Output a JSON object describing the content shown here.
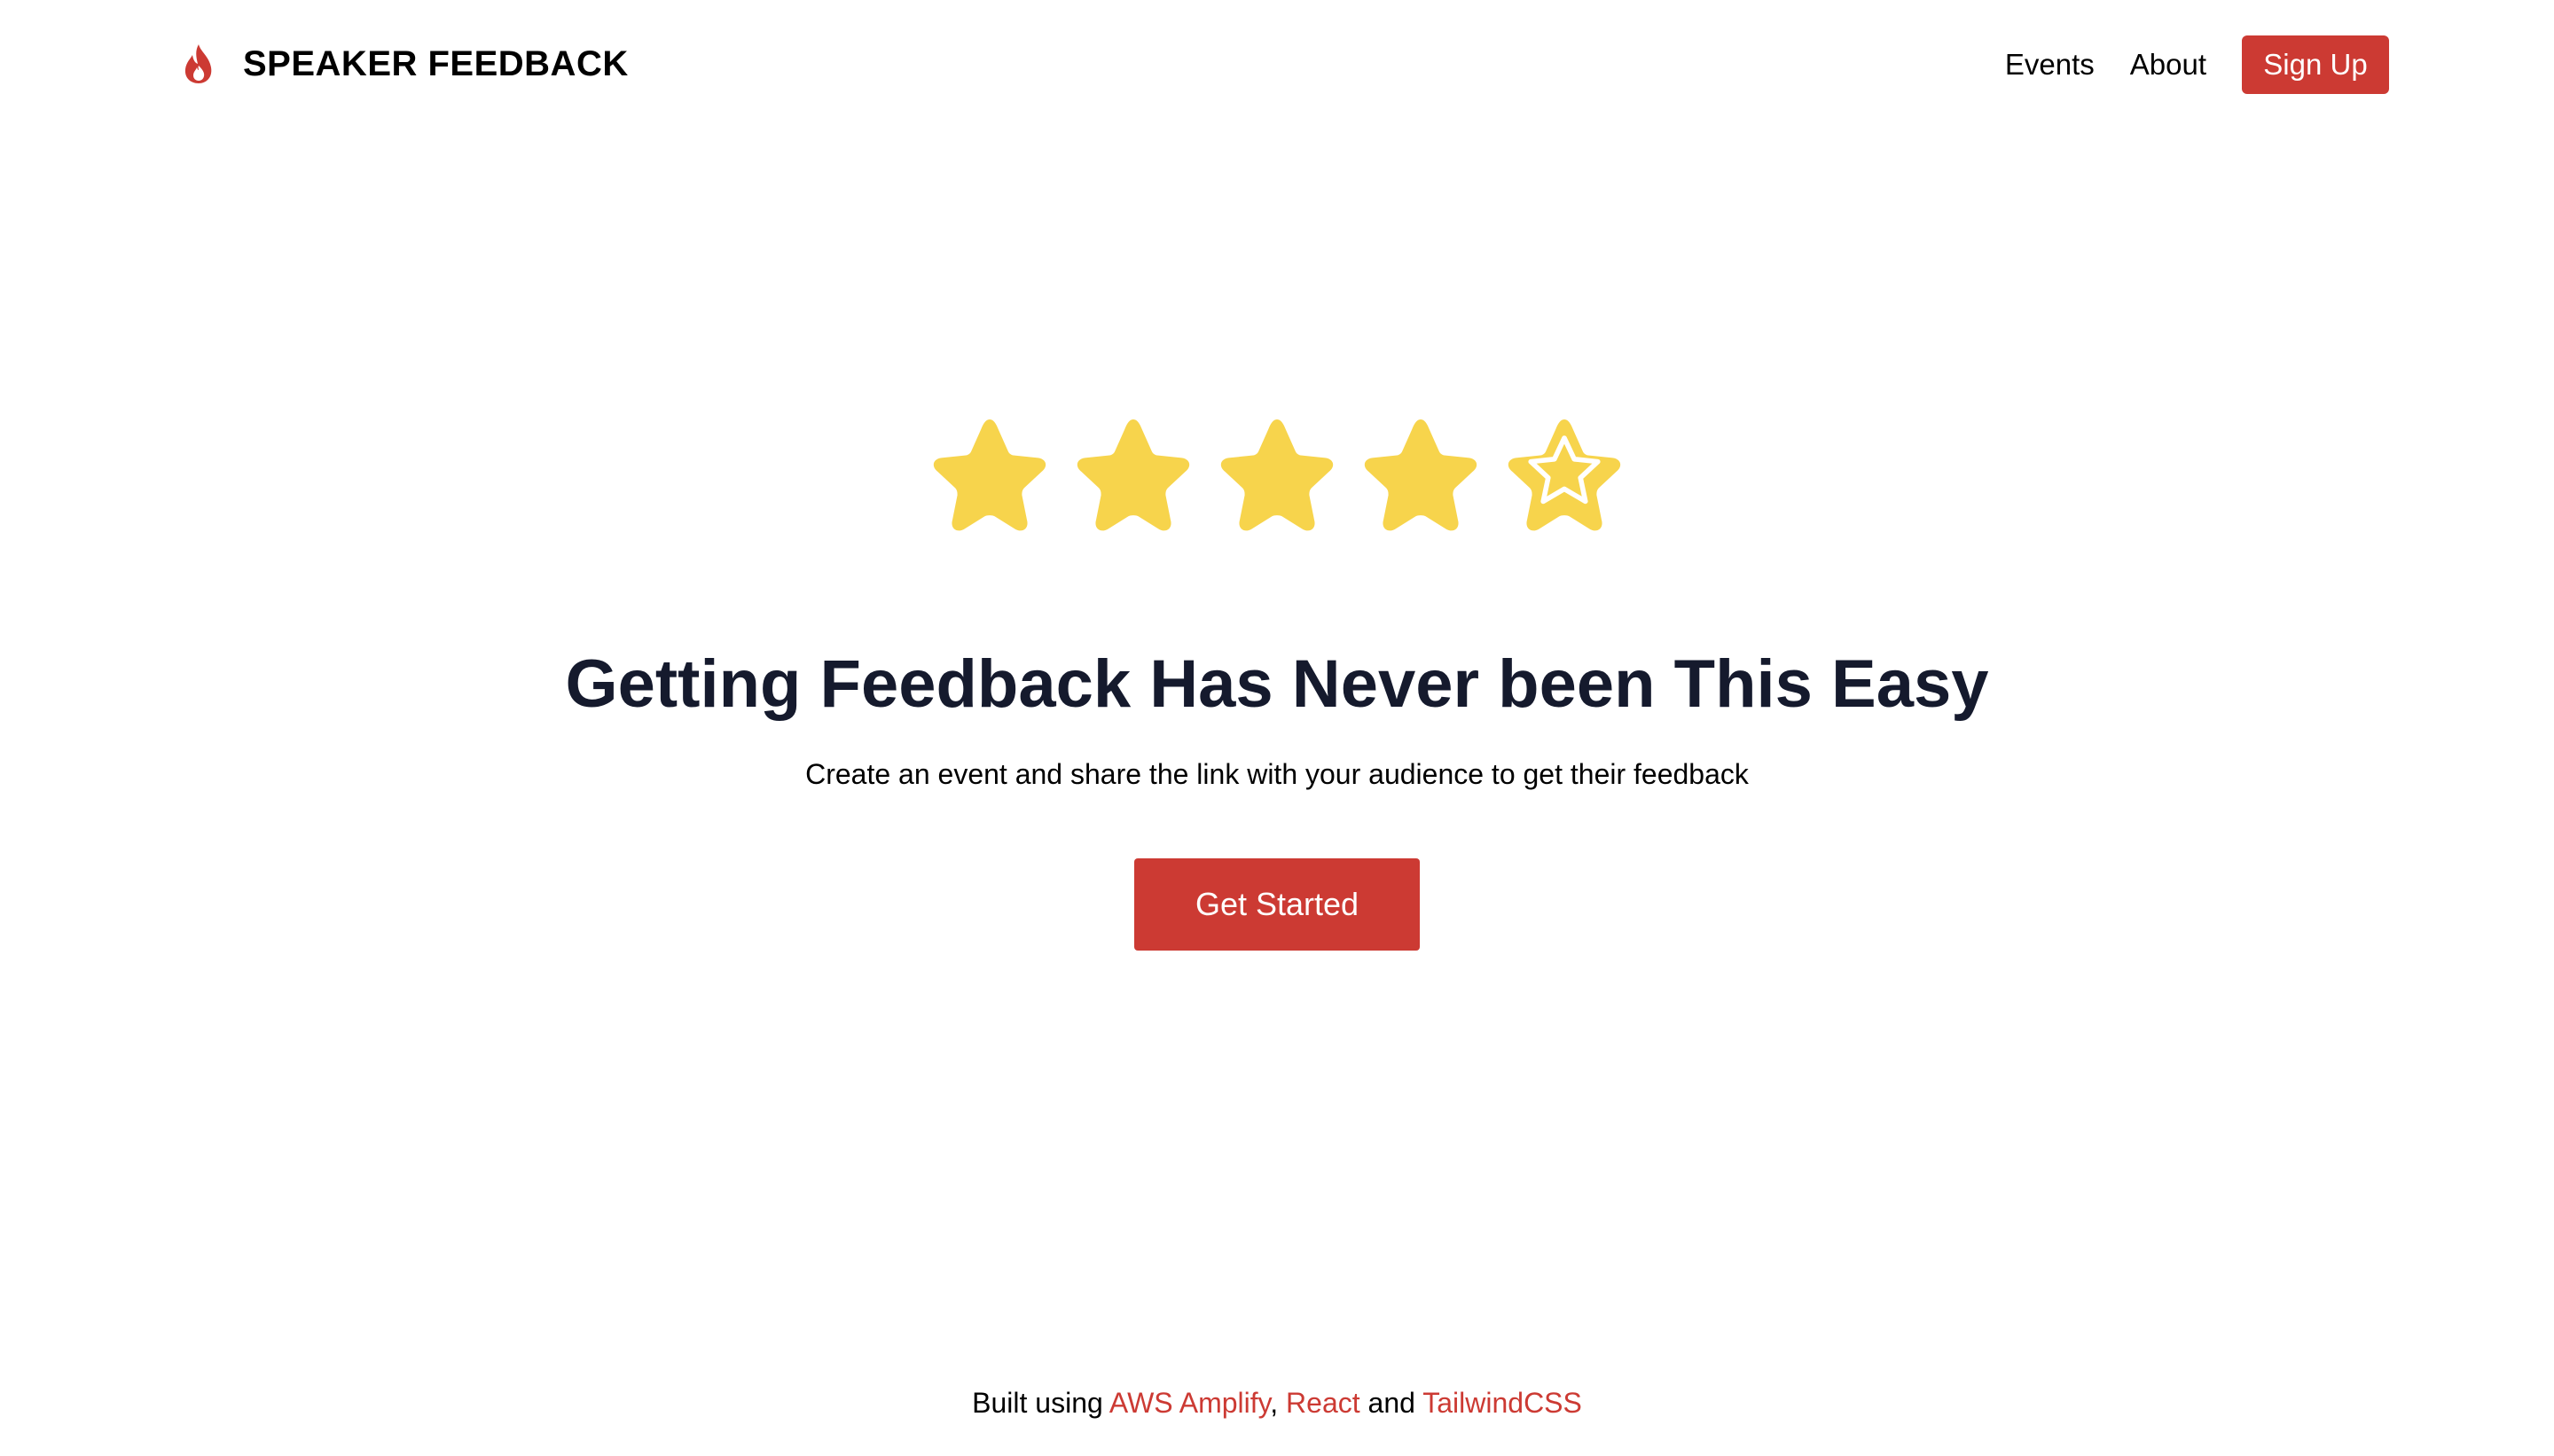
{
  "header": {
    "brand_title": "SPEAKER FEEDBACK",
    "brand_icon": "flame-icon",
    "nav": {
      "events_label": "Events",
      "about_label": "About",
      "signup_label": "Sign Up"
    }
  },
  "hero": {
    "rating": {
      "filled": 4,
      "outlined": 1,
      "max": 5
    },
    "star_color": "#f7d44c",
    "title": "Getting Feedback Has Never been This Easy",
    "subtitle": "Create an event and share the link with your audience to get their feedback",
    "cta_label": "Get Started"
  },
  "footer": {
    "prefix": "Built using ",
    "link1": "AWS Amplify",
    "sep1": ", ",
    "link2": "React",
    "sep2": " and ",
    "link3": "TailwindCSS"
  },
  "colors": {
    "accent": "#cc3a33",
    "heading": "#151a2d"
  }
}
